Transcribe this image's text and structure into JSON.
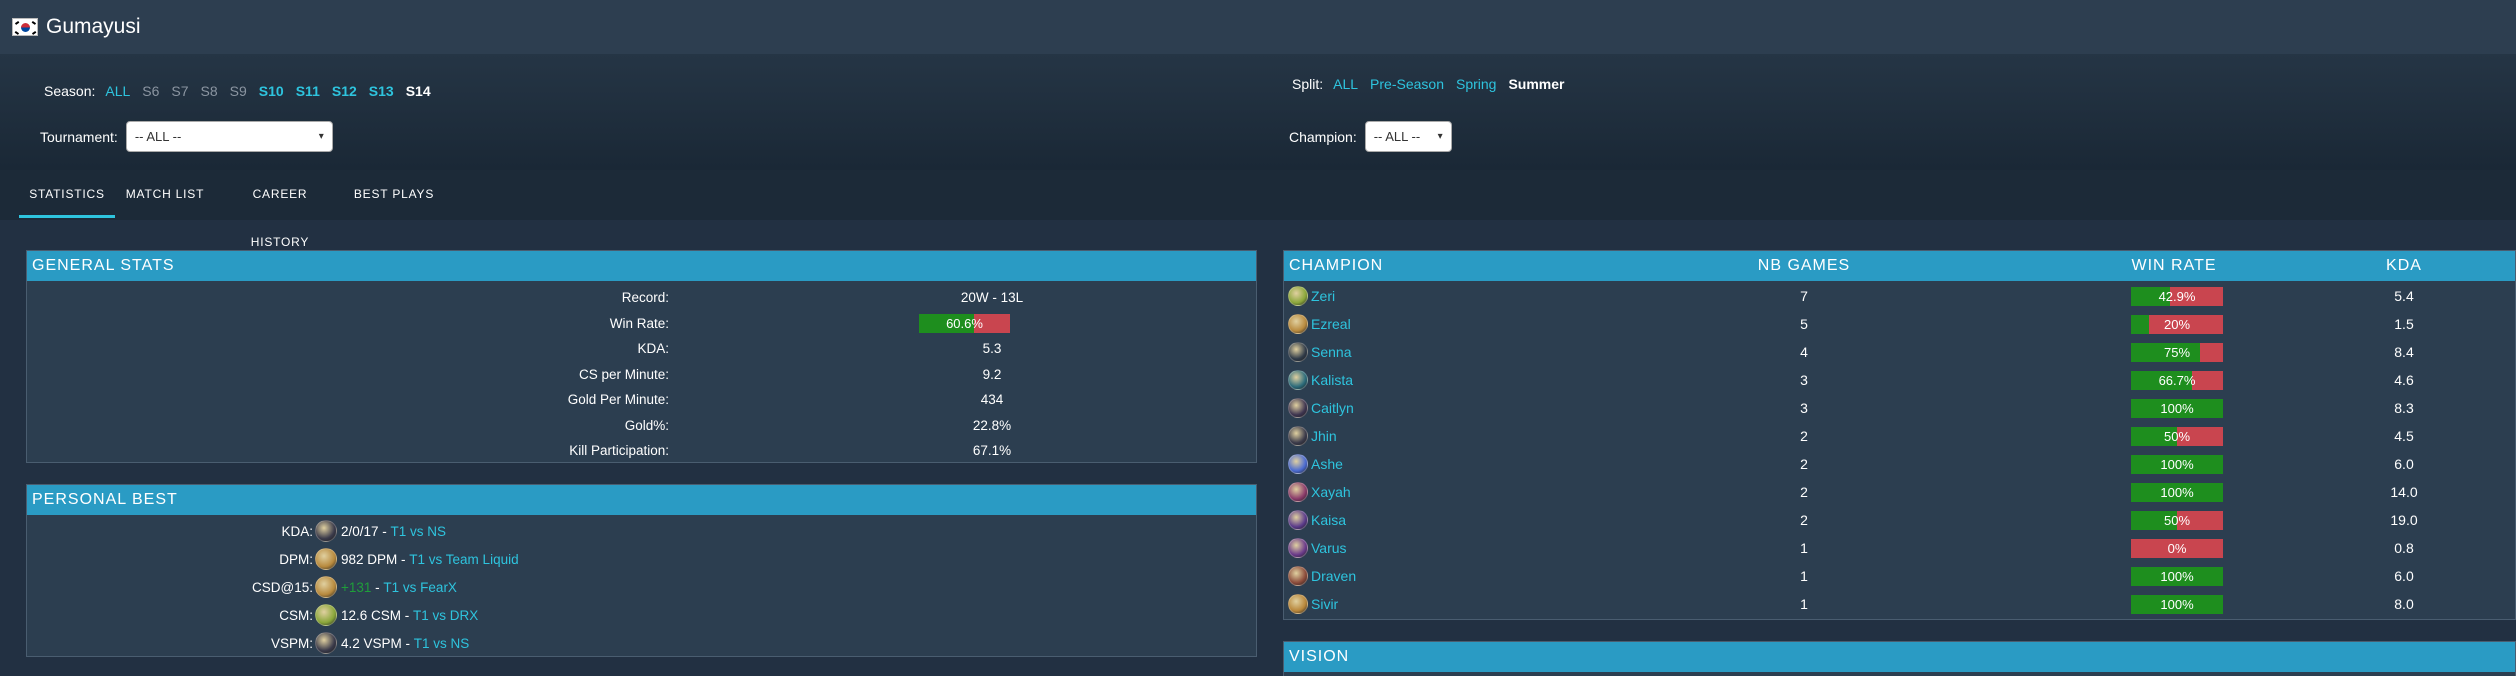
{
  "player": {
    "name": "Gumayusi",
    "flag": "south-korea-flag-icon"
  },
  "filters": {
    "season_label": "Season:",
    "seasons": [
      {
        "label": "ALL",
        "style": "active"
      },
      {
        "label": "S6",
        "style": "muted"
      },
      {
        "label": "S7",
        "style": "muted"
      },
      {
        "label": "S8",
        "style": "muted"
      },
      {
        "label": "S9",
        "style": "muted"
      },
      {
        "label": "S10",
        "style": "bold"
      },
      {
        "label": "S11",
        "style": "bold"
      },
      {
        "label": "S12",
        "style": "bold"
      },
      {
        "label": "S13",
        "style": "bold"
      },
      {
        "label": "S14",
        "style": "selected"
      }
    ],
    "split_label": "Split:",
    "splits": [
      {
        "label": "ALL",
        "style": "active"
      },
      {
        "label": "Pre-Season",
        "style": "active"
      },
      {
        "label": "Spring",
        "style": "active"
      },
      {
        "label": "Summer",
        "style": "selected"
      }
    ],
    "tournament_label": "Tournament:",
    "tournament_value": "-- ALL --",
    "champion_label": "Champion:",
    "champion_value": "-- ALL --"
  },
  "tabs": [
    {
      "label": "STATISTICS",
      "active": true
    },
    {
      "label": "MATCH LIST",
      "active": false
    },
    {
      "label": "CAREER HISTORY",
      "active": false
    },
    {
      "label": "BEST PLAYS",
      "active": false
    }
  ],
  "general_stats": {
    "title": "GENERAL STATS",
    "rows": [
      {
        "label": "Record:",
        "value": "20W - 13L"
      },
      {
        "label": "Win Rate:",
        "value": "60.6%",
        "rate": 0.606
      },
      {
        "label": "KDA:",
        "value": "5.3"
      },
      {
        "label": "CS per Minute:",
        "value": "9.2"
      },
      {
        "label": "Gold Per Minute:",
        "value": "434"
      },
      {
        "label": "Gold%:",
        "value": "22.8%"
      },
      {
        "label": "Kill Participation:",
        "value": "67.1%"
      }
    ]
  },
  "personal_best": {
    "title": "PERSONAL BEST",
    "rows": [
      {
        "label": "KDA:",
        "champion_icon": "jhin-icon",
        "icon_color": "#3a3a4a",
        "value": "2/0/17",
        "separator": " - ",
        "match": "T1 vs NS",
        "value_color": "white"
      },
      {
        "label": "DPM:",
        "champion_icon": "ezreal-icon",
        "icon_color": "#b88a3e",
        "value": "982 DPM",
        "separator": " - ",
        "match": "T1 vs Team Liquid",
        "value_color": "white"
      },
      {
        "label": "CSD@15:",
        "champion_icon": "ezreal-icon",
        "icon_color": "#b88a3e",
        "value": "+131",
        "separator": " - ",
        "match": "T1 vs FearX",
        "value_color": "green"
      },
      {
        "label": "CSM:",
        "champion_icon": "zeri-icon",
        "icon_color": "#8aa63a",
        "value": "12.6 CSM",
        "separator": " - ",
        "match": "T1 vs DRX",
        "value_color": "white"
      },
      {
        "label": "VSPM:",
        "champion_icon": "jhin-icon",
        "icon_color": "#3a3a4a",
        "value": "4.2 VSPM",
        "separator": " - ",
        "match": "T1 vs NS",
        "value_color": "white"
      }
    ]
  },
  "champion_table": {
    "headers": {
      "champion": "CHAMPION",
      "games": "NB GAMES",
      "winrate": "WIN RATE",
      "kda": "KDA"
    },
    "rows": [
      {
        "name": "Zeri",
        "icon": "zeri-icon",
        "icon_color": "#8aa63a",
        "games": "7",
        "winrate": "42.9%",
        "rate": 0.429,
        "kda": "5.4"
      },
      {
        "name": "Ezreal",
        "icon": "ezreal-icon",
        "icon_color": "#b88a3e",
        "games": "5",
        "winrate": "20%",
        "rate": 0.2,
        "kda": "1.5"
      },
      {
        "name": "Senna",
        "icon": "senna-icon",
        "icon_color": "#2f3a48",
        "games": "4",
        "winrate": "75%",
        "rate": 0.75,
        "kda": "8.4"
      },
      {
        "name": "Kalista",
        "icon": "kalista-icon",
        "icon_color": "#2a6a7a",
        "games": "3",
        "winrate": "66.7%",
        "rate": 0.667,
        "kda": "4.6"
      },
      {
        "name": "Caitlyn",
        "icon": "caitlyn-icon",
        "icon_color": "#3e3550",
        "games": "3",
        "winrate": "100%",
        "rate": 1.0,
        "kda": "8.3"
      },
      {
        "name": "Jhin",
        "icon": "jhin-icon",
        "icon_color": "#3a3a4a",
        "games": "2",
        "winrate": "50%",
        "rate": 0.5,
        "kda": "4.5"
      },
      {
        "name": "Ashe",
        "icon": "ashe-icon",
        "icon_color": "#4a6ad0",
        "games": "2",
        "winrate": "100%",
        "rate": 1.0,
        "kda": "6.0"
      },
      {
        "name": "Xayah",
        "icon": "xayah-icon",
        "icon_color": "#8a3a6a",
        "games": "2",
        "winrate": "100%",
        "rate": 1.0,
        "kda": "14.0"
      },
      {
        "name": "Kaisa",
        "icon": "kaisa-icon",
        "icon_color": "#5a3a8a",
        "games": "2",
        "winrate": "50%",
        "rate": 0.5,
        "kda": "19.0"
      },
      {
        "name": "Varus",
        "icon": "varus-icon",
        "icon_color": "#6a3a8a",
        "games": "1",
        "winrate": "0%",
        "rate": 0.0,
        "kda": "0.8"
      },
      {
        "name": "Draven",
        "icon": "draven-icon",
        "icon_color": "#8a4a3a",
        "games": "1",
        "winrate": "100%",
        "rate": 1.0,
        "kda": "6.0"
      },
      {
        "name": "Sivir",
        "icon": "sivir-icon",
        "icon_color": "#b8863a",
        "games": "1",
        "winrate": "100%",
        "rate": 1.0,
        "kda": "8.0"
      }
    ]
  },
  "vision": {
    "title": "VISION"
  },
  "colors": {
    "accent": "#2ec4de",
    "header_blue": "#2a9bc4",
    "win_green": "#1e8e1e",
    "loss_red": "#c9454f",
    "bg": "#223042",
    "panel": "#2c3e50"
  }
}
